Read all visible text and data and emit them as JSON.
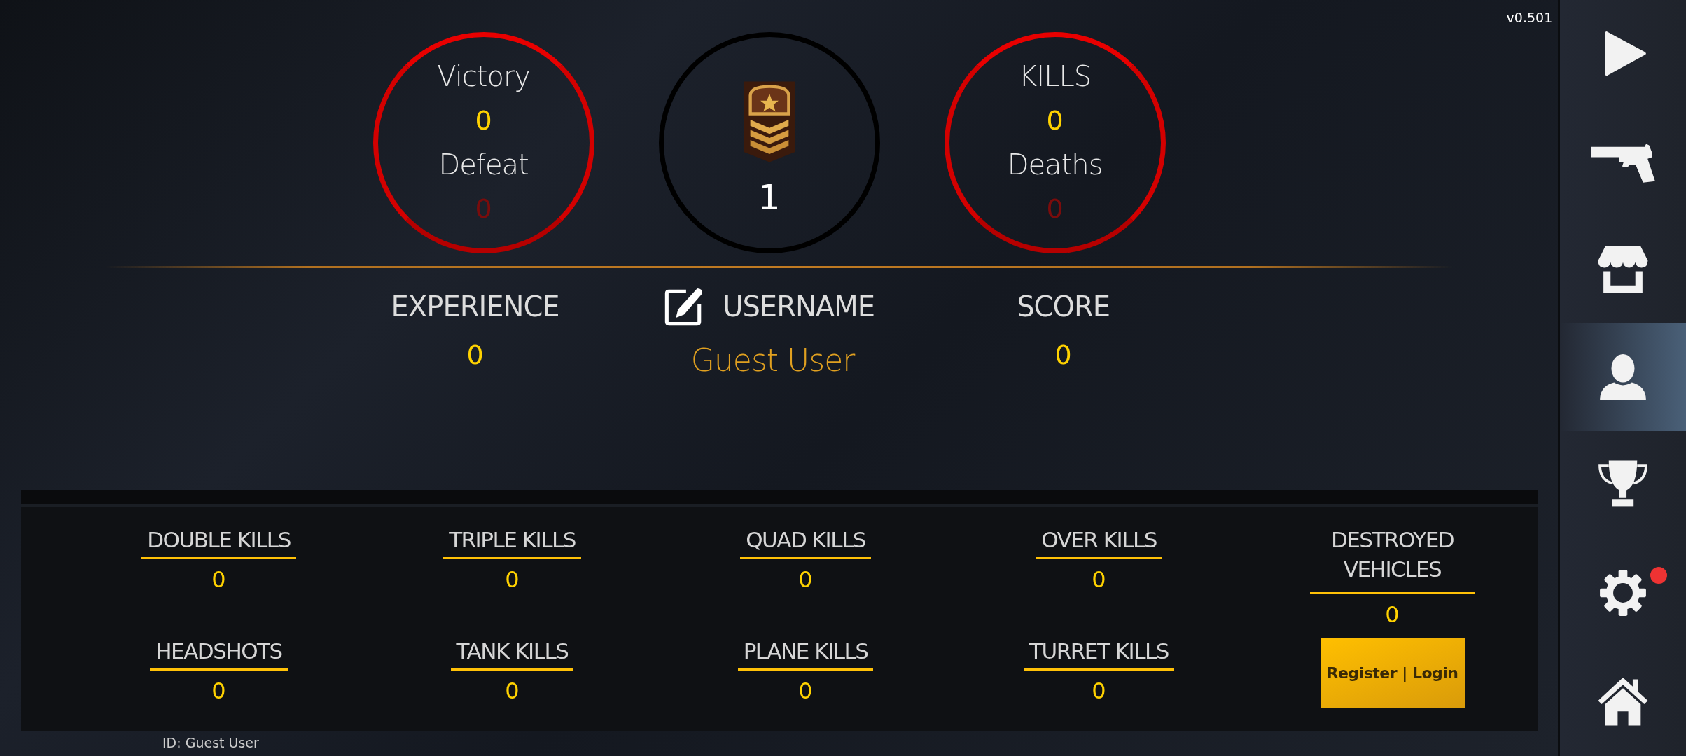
{
  "version": "v0.501",
  "circles": [
    {
      "kind": "ratio",
      "stats": [
        {
          "label": "Victory",
          "value": "0",
          "kind": "good"
        },
        {
          "label": "Defeat",
          "value": "0",
          "kind": "bad"
        }
      ]
    },
    {
      "kind": "rank",
      "value": "1"
    },
    {
      "kind": "ratio",
      "stats": [
        {
          "label": "KILLS",
          "value": "0",
          "kind": "good"
        },
        {
          "label": "Deaths",
          "value": "0",
          "kind": "bad"
        }
      ]
    }
  ],
  "summary": [
    {
      "label": "EXPERIENCE",
      "value": "0",
      "editable": false
    },
    {
      "label": "USERNAME",
      "value": "Guest User",
      "editable": true
    },
    {
      "label": "SCORE",
      "value": "0",
      "editable": false
    }
  ],
  "stats": [
    {
      "label": "DOUBLE KILLS",
      "value": "0"
    },
    {
      "label": "TRIPLE KILLS",
      "value": "0"
    },
    {
      "label": "QUAD KILLS",
      "value": "0"
    },
    {
      "label": "OVER KILLS",
      "value": "0"
    },
    {
      "label": "DESTROYED VEHICLES",
      "value": "0"
    },
    {
      "label": "HEADSHOTS",
      "value": "0"
    },
    {
      "label": "TANK KILLS",
      "value": "0"
    },
    {
      "label": "PLANE KILLS",
      "value": "0"
    },
    {
      "label": "TURRET KILLS",
      "value": "0"
    }
  ],
  "register_button": "Register | Login",
  "id_line": "ID: Guest User",
  "sidebar": [
    {
      "kind": "play",
      "selected": false,
      "notification": false
    },
    {
      "kind": "weapons",
      "selected": false,
      "notification": false
    },
    {
      "kind": "shop",
      "selected": false,
      "notification": false
    },
    {
      "kind": "profile",
      "selected": true,
      "notification": false
    },
    {
      "kind": "trophy",
      "selected": false,
      "notification": false
    },
    {
      "kind": "settings",
      "selected": false,
      "notification": true
    },
    {
      "kind": "home",
      "selected": false,
      "notification": false
    }
  ]
}
